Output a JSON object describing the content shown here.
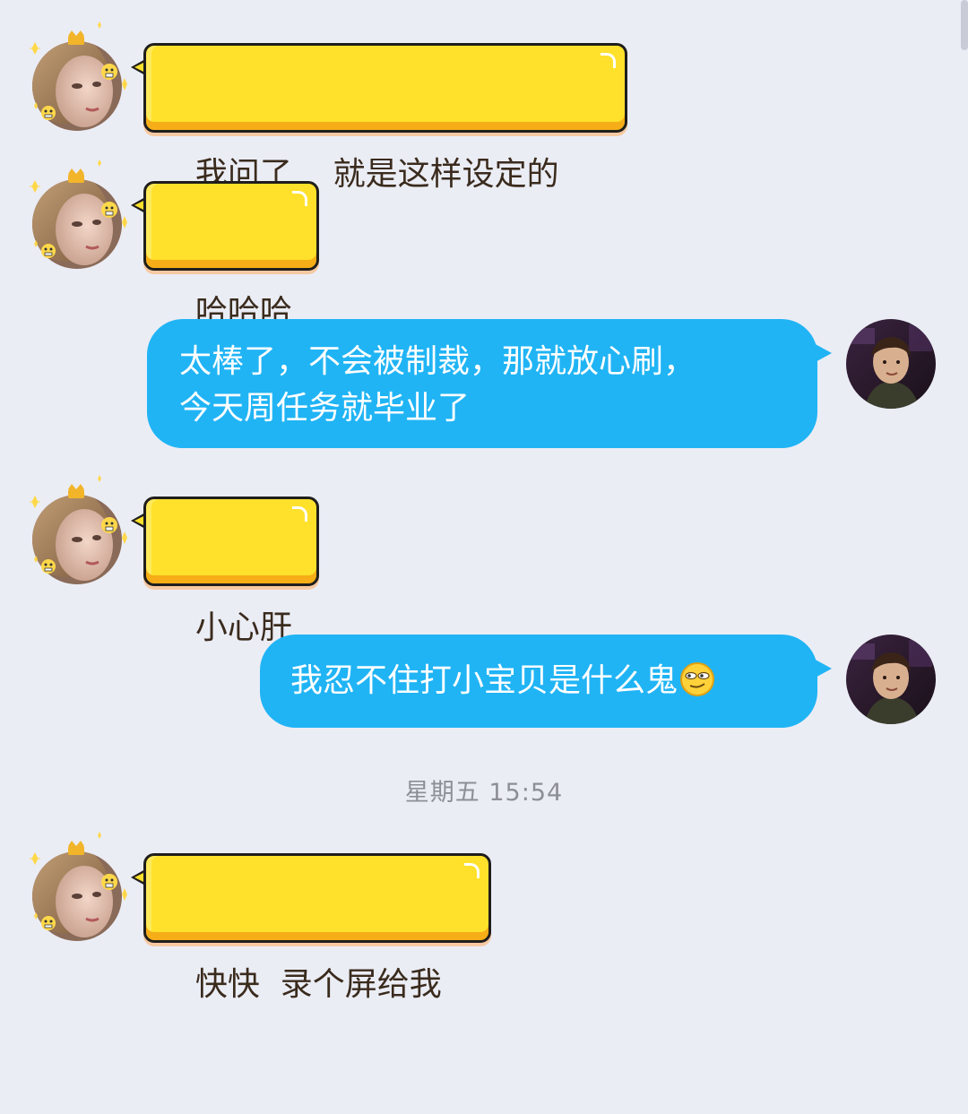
{
  "messages": [
    {
      "sender": "other",
      "text": "我问了    就是这样设定的"
    },
    {
      "sender": "other",
      "text": "哈哈哈"
    },
    {
      "sender": "self",
      "lines": [
        "太棒了，不会被制裁，那就放心刷，",
        "今天周任务就毕业了"
      ]
    },
    {
      "sender": "other",
      "text": "小心肝"
    },
    {
      "sender": "self",
      "text": "我忍不住打小宝贝是什么鬼",
      "emoji": "smirk-emoji"
    },
    {
      "sender": "other",
      "text": "快快  录个屏给我"
    }
  ],
  "timestamp": "星期五  15:54",
  "colors": {
    "background": "#ebedf5",
    "incoming_bubble": "#ffe12b",
    "incoming_bubble_border": "#1f1e1c",
    "outgoing_bubble": "#20b4f5",
    "outgoing_text": "#ffffff",
    "timestamp_text": "#8d8f96"
  },
  "icons": {
    "other_avatar": "woman-portrait-avatar",
    "self_avatar": "man-portrait-avatar",
    "avatar_decoration": "sparkle-crown-emoji-frame"
  }
}
